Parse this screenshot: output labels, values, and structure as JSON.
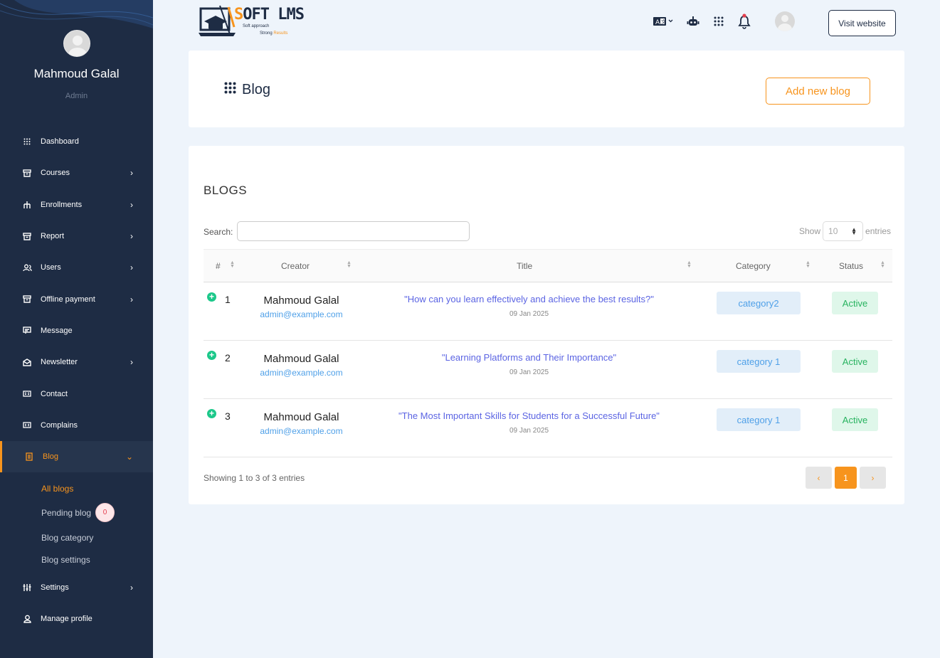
{
  "user": {
    "name": "Mahmoud Galal",
    "role": "Admin"
  },
  "menu": {
    "items": [
      {
        "label": "Dashboard",
        "icon": "grid-icon"
      },
      {
        "label": "Courses",
        "icon": "box-icon"
      },
      {
        "label": "Enrollments",
        "icon": "hierarchy-icon"
      },
      {
        "label": "Report",
        "icon": "archive-icon"
      },
      {
        "label": "Users",
        "icon": "users-icon"
      },
      {
        "label": "Offline payment",
        "icon": "archive-icon"
      },
      {
        "label": "Message",
        "icon": "message-icon"
      },
      {
        "label": "Newsletter",
        "icon": "envelope-icon"
      },
      {
        "label": "Contact",
        "icon": "id-card-icon"
      },
      {
        "label": "Complains",
        "icon": "id-card-icon"
      },
      {
        "label": "Blog",
        "icon": "document-icon"
      }
    ],
    "blog_sub": {
      "all": "All blogs",
      "pending": "Pending blog",
      "pending_count": "0",
      "category": "Blog category",
      "settings": "Blog settings"
    },
    "settings": "Settings",
    "manage_profile": "Manage profile"
  },
  "header": {
    "logo_title_s": "S",
    "logo_title_rest": "OFT LMS",
    "logo_sub1": "Soft approach",
    "logo_sub2a": "Strong ",
    "logo_sub2b": "Results",
    "visit": "Visit website"
  },
  "page": {
    "title": "Blog",
    "add_button": "Add new blog"
  },
  "table": {
    "heading": "BLOGS",
    "search_label": "Search:",
    "show_label": "Show",
    "show_value": "10",
    "entries_label": "entries",
    "columns": {
      "num": "#",
      "creator": "Creator",
      "title": "Title",
      "category": "Category",
      "status": "Status"
    },
    "rows": [
      {
        "num": "1",
        "creator": "Mahmoud Galal",
        "email": "admin@example.com",
        "title": "\"How can you learn effectively and achieve the best results?\"",
        "date": "09 Jan 2025",
        "category": "category2",
        "status": "Active"
      },
      {
        "num": "2",
        "creator": "Mahmoud Galal",
        "email": "admin@example.com",
        "title": "\"Learning Platforms and Their Importance\"",
        "date": "09 Jan 2025",
        "category": "category 1",
        "status": "Active"
      },
      {
        "num": "3",
        "creator": "Mahmoud Galal",
        "email": "admin@example.com",
        "title": "\"The Most Important Skills for Students for a Successful Future\"",
        "date": "09 Jan 2025",
        "category": "category 1",
        "status": "Active"
      }
    ],
    "showing": "Showing 1 to 3 of 3 entries",
    "pager": {
      "prev": "‹",
      "current": "1",
      "next": "›"
    }
  },
  "colors": {
    "sidebar": "#1e2c44",
    "accent": "#f7941d",
    "link": "#4fa0e8",
    "title_link": "#5b64e3",
    "success": "#27b35f"
  }
}
